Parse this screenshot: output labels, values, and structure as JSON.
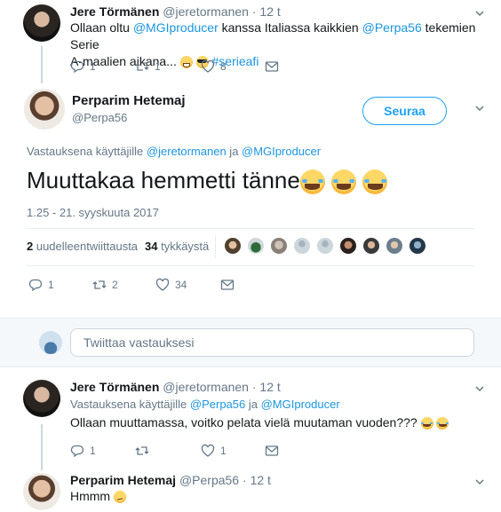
{
  "tweet1": {
    "name": "Jere Törmänen",
    "handle": "@jeretormanen",
    "sep": "·",
    "time": "12 t",
    "text_part1": "Ollaan oltu ",
    "mention1": "@MGIproducer",
    "text_part2": " kanssa Italiassa kaikkien ",
    "mention2": "@Perpa56",
    "text_part3": " tekemien Serie",
    "text_line2": "A-maalien aikana... ",
    "hashtag": "#seriea​fi",
    "replies": "1",
    "retweets": "1",
    "likes": "8"
  },
  "main_tweet": {
    "name": "Perparim Hetemaj",
    "handle": "@Perpa56",
    "follow_label": "Seuraa",
    "reply_prefix": "Vastauksena käyttäjille ",
    "reply_to1": "@jeretormanen",
    "reply_and": " ja ",
    "reply_to2": "@MGIproducer",
    "text": "Muuttakaa hemmetti tänne",
    "timestamp": "1.25 - 21. syyskuuta 2017",
    "retweet_count": "2",
    "retweet_label": " uudelleentwiittausta",
    "like_count": "34",
    "like_label": " tykkäystä",
    "replies": "1",
    "retweets": "2",
    "likes": "34"
  },
  "reply_box": {
    "placeholder": "Twiittaa vastauksesi"
  },
  "tweet3": {
    "name": "Jere Törmänen",
    "handle": "@jeretormanen",
    "sep": "·",
    "time": "12 t",
    "reply_prefix": "Vastauksena käyttäjille ",
    "reply_to1": "@Perpa56",
    "reply_and": " ja ",
    "reply_to2": "@MGIproducer",
    "text": "Ollaan muuttamassa, voitko pelata vielä muutaman vuoden??? ",
    "replies": "1",
    "retweets": "",
    "likes": "1"
  },
  "tweet4": {
    "name": "Perparim Hetemaj",
    "handle": "@Perpa56",
    "sep": "·",
    "time": "12 t",
    "text": "Hmmm "
  },
  "icons": [
    "chevron-down-icon",
    "reply-icon",
    "retweet-icon",
    "like-icon",
    "message-icon"
  ],
  "colors": {
    "link": "#1b95e0",
    "muted": "#657786",
    "accent": "#1da1f2",
    "divider": "#e6ecf0"
  }
}
